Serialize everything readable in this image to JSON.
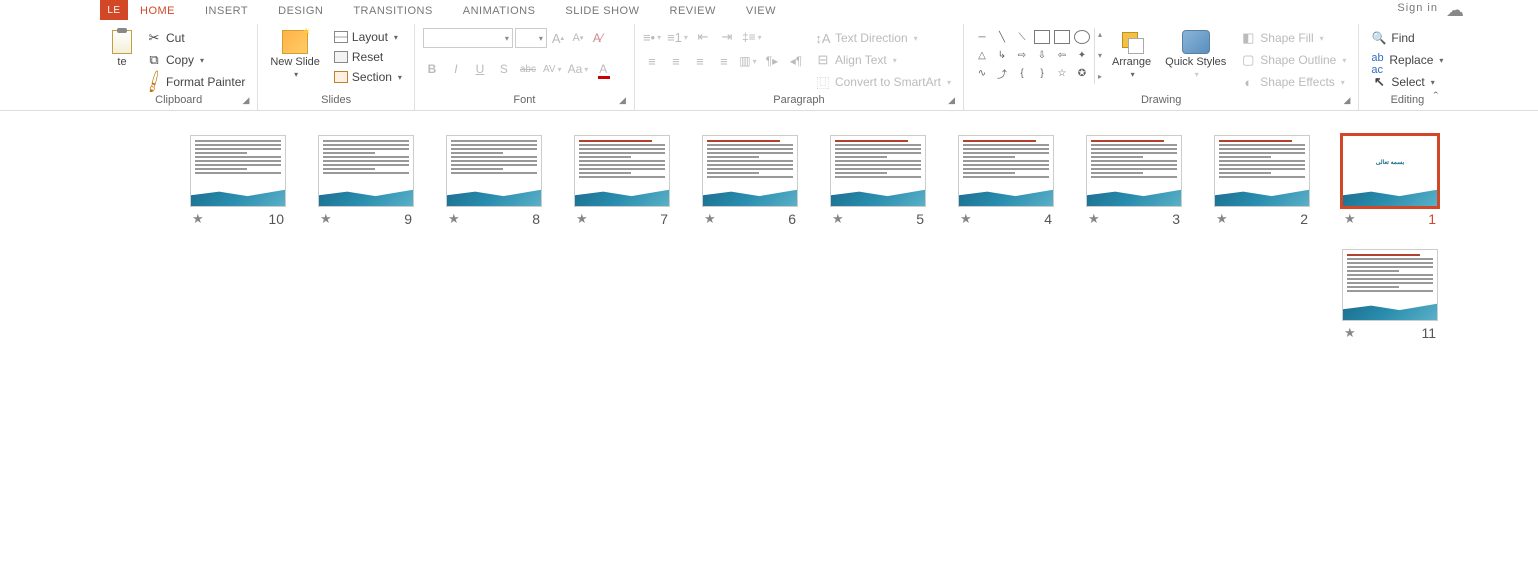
{
  "tabs": {
    "file": "LE",
    "items": [
      "HOME",
      "INSERT",
      "DESIGN",
      "TRANSITIONS",
      "ANIMATIONS",
      "SLIDE SHOW",
      "REVIEW",
      "VIEW"
    ],
    "active_index": 0,
    "signin": "Sign in"
  },
  "clipboard": {
    "paste": "te",
    "cut": "Cut",
    "copy": "Copy",
    "format_painter": "Format Painter",
    "label": "Clipboard"
  },
  "slides": {
    "new_slide": "New Slide",
    "layout": "Layout",
    "reset": "Reset",
    "section": "Section",
    "label": "Slides"
  },
  "font": {
    "label": "Font",
    "bold": "B",
    "italic": "I",
    "underline": "U",
    "shadow": "S",
    "strike": "abc",
    "spacing": "AV",
    "case": "Aa",
    "clear": "A",
    "grow": "A",
    "shrink": "A",
    "color": "A"
  },
  "paragraph": {
    "label": "Paragraph",
    "text_direction": "Text Direction",
    "align_text": "Align Text",
    "smartart": "Convert to SmartArt"
  },
  "drawing": {
    "label": "Drawing",
    "arrange": "Arrange",
    "quick_styles": "Quick Styles",
    "shape_fill": "Shape Fill",
    "shape_outline": "Shape Outline",
    "shape_effects": "Shape Effects"
  },
  "editing": {
    "label": "Editing",
    "find": "Find",
    "replace": "Replace",
    "select": "Select"
  },
  "thumbnails": {
    "count": 11,
    "selected": 1,
    "title_slide": 1
  }
}
